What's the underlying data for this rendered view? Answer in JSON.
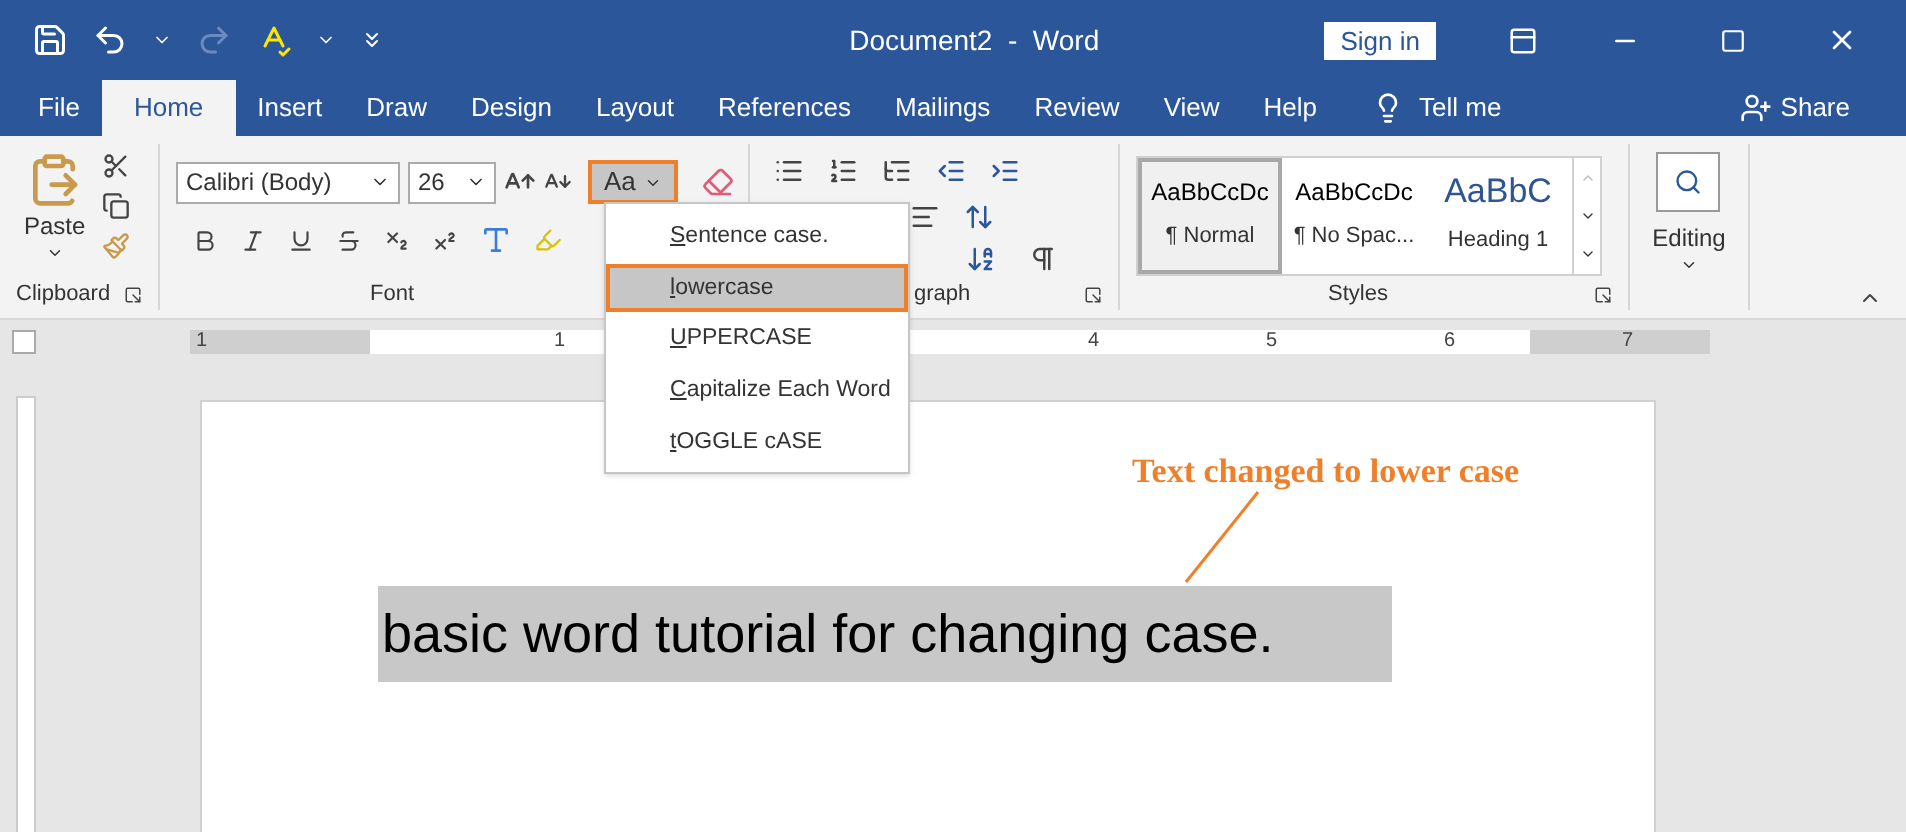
{
  "title_bar": {
    "document_title": "Document2  -  Word",
    "sign_in": "Sign in"
  },
  "tabs": [
    {
      "label": "File",
      "selected": false
    },
    {
      "label": "Home",
      "selected": true
    },
    {
      "label": "Insert",
      "selected": false
    },
    {
      "label": "Draw",
      "selected": false
    },
    {
      "label": "Design",
      "selected": false
    },
    {
      "label": "Layout",
      "selected": false
    },
    {
      "label": "References",
      "selected": false
    },
    {
      "label": "Mailings",
      "selected": false
    },
    {
      "label": "Review",
      "selected": false
    },
    {
      "label": "View",
      "selected": false
    },
    {
      "label": "Help",
      "selected": false
    }
  ],
  "tell_me": "Tell me",
  "share": "Share",
  "ribbon": {
    "clipboard": {
      "paste": "Paste",
      "label": "Clipboard"
    },
    "font": {
      "font_name": "Calibri (Body)",
      "font_size": "26",
      "change_case": "Aa",
      "change_case_open": true,
      "label": "Font"
    },
    "paragraph": {
      "label": "graph"
    },
    "styles": {
      "label": "Styles",
      "items": [
        {
          "preview": "AaBbCcDc",
          "name": "¶ Normal",
          "selected": true,
          "kind": "normal"
        },
        {
          "preview": "AaBbCcDc",
          "name": "¶ No Spac...",
          "selected": false,
          "kind": "normal"
        },
        {
          "preview": "AaBbC",
          "name": "Heading 1",
          "selected": false,
          "kind": "heading"
        }
      ]
    },
    "editing": {
      "label": "Editing"
    }
  },
  "change_case_menu": [
    {
      "label": "Sentence case.",
      "selected": false
    },
    {
      "label": "lowercase",
      "selected": true
    },
    {
      "label": "UPPERCASE",
      "selected": false
    },
    {
      "label": "Capitalize Each Word",
      "selected": false
    },
    {
      "label": "tOGGLE cASE",
      "selected": false
    }
  ],
  "ruler": [
    "1",
    "1",
    "4",
    "5",
    "6",
    "7"
  ],
  "document": {
    "text": "basic word tutorial for changing case.",
    "annotation": "Text changed to lower case"
  }
}
